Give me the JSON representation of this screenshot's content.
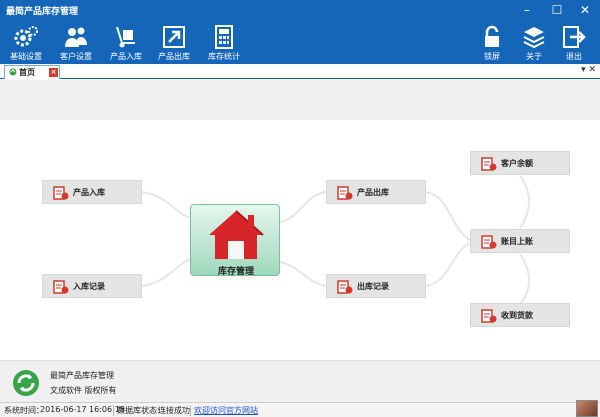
{
  "window": {
    "title": "最简产品库存管理"
  },
  "toolbar": {
    "left": [
      "基础设置",
      "客户设置",
      "产品入库",
      "产品出库",
      "库存统计"
    ],
    "right": [
      "锁屏",
      "关于",
      "退出"
    ]
  },
  "tab": {
    "label": "首页",
    "close": "×"
  },
  "diagram": {
    "center": "库存管理",
    "nodes": [
      "产品入库",
      "入库记录",
      "产品出库",
      "出库记录",
      "客户余额",
      "账目上账",
      "收到货款"
    ]
  },
  "footer": {
    "line1": "最简产品库存管理",
    "line2": "文成软件 版权所有"
  },
  "status": {
    "time_label": "系统时间：",
    "time_value": "2016-06-17 16:06:18",
    "db_label": "数据库状态：",
    "db_value": "连接成功",
    "link": "欢迎访问官方网站"
  },
  "colors": {
    "accent": "#1565b8",
    "node_icon": "#d23a2e",
    "house": "#d7262a"
  }
}
